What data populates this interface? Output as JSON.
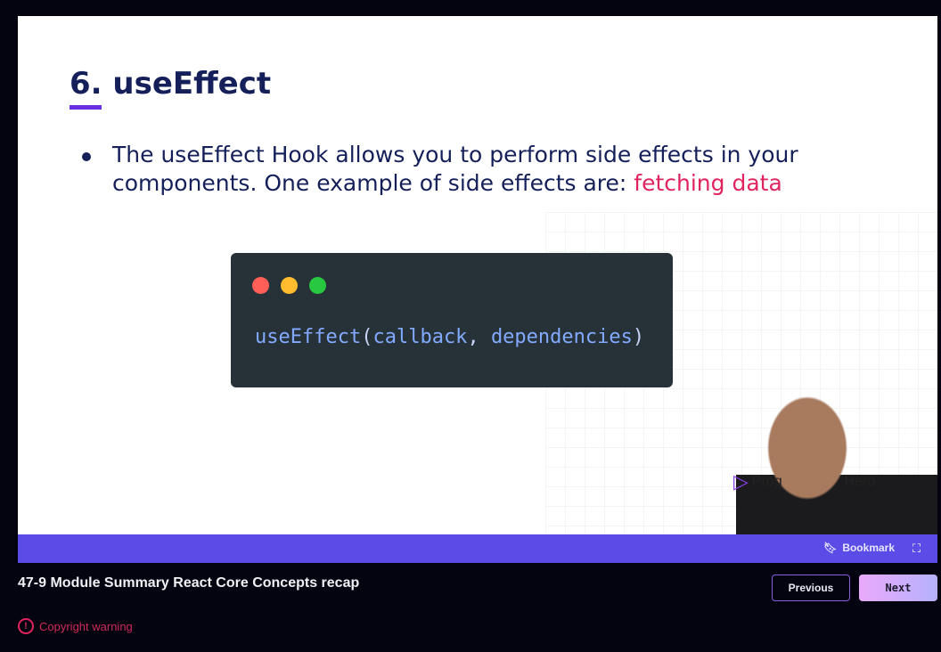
{
  "slide": {
    "title": "6. useEffect",
    "bullet_text": "The useEffect Hook allows you to perform side effects in your components. One example of side effects are: ",
    "bullet_highlight": "fetching data",
    "code": {
      "fn": "useEffect",
      "open": "(",
      "arg1": "callback",
      "sep": ", ",
      "arg2": "dependencies",
      "close": ")"
    },
    "logo_left": "Prog",
    "logo_right": "Hero"
  },
  "controls": {
    "bookmark_label": "Bookmark"
  },
  "lesson_title": "47-9 Module Summary React Core Concepts recap",
  "buttons": {
    "previous": "Previous",
    "next": "Next"
  },
  "copyright_warning": "Copyright warning",
  "colors": {
    "bar": "#5b4ce8",
    "accent": "#6a2fe0",
    "highlight": "#e0245e"
  }
}
